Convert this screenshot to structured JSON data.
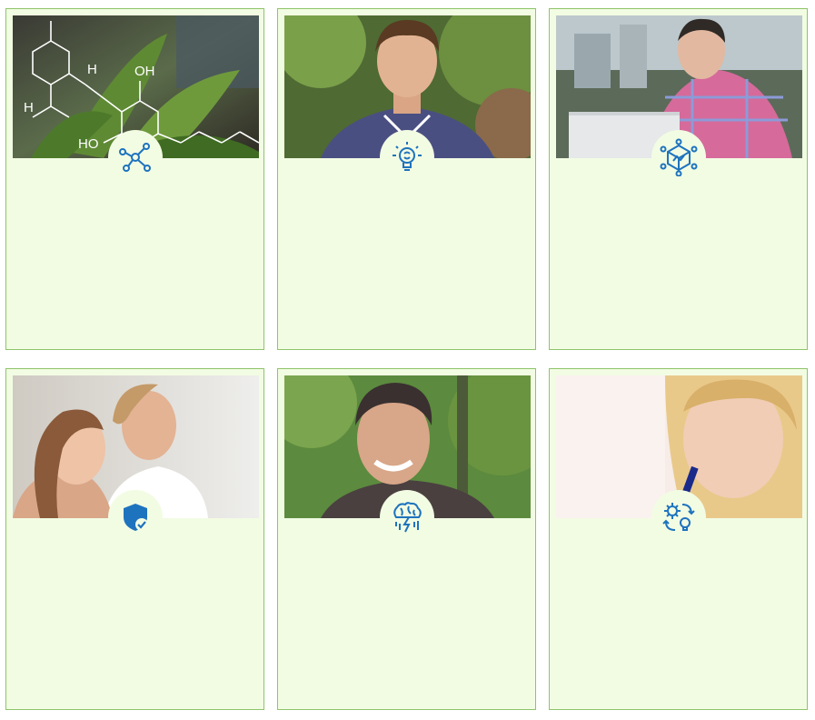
{
  "cards": [
    {
      "icon": "molecule-icon",
      "photo": "cannabis-molecule-photo",
      "chem_labels": {
        "oh": "OH",
        "ho": "HO",
        "h1": "H",
        "h2": "H"
      }
    },
    {
      "icon": "lightbulb-brain-icon",
      "photo": "young-man-striped-shirt-photo"
    },
    {
      "icon": "cube-network-icon",
      "photo": "man-laptop-plaid-shirt-photo"
    },
    {
      "icon": "shield-check-icon",
      "photo": "couple-breathing-photo"
    },
    {
      "icon": "brain-storm-icon",
      "photo": "smiling-man-photo"
    },
    {
      "icon": "gear-lightbulb-cycle-icon",
      "photo": "woman-thinking-photo"
    }
  ],
  "colors": {
    "card_bg": "#f2fce3",
    "card_border": "#8fc46a",
    "icon_blue": "#1e73be"
  }
}
